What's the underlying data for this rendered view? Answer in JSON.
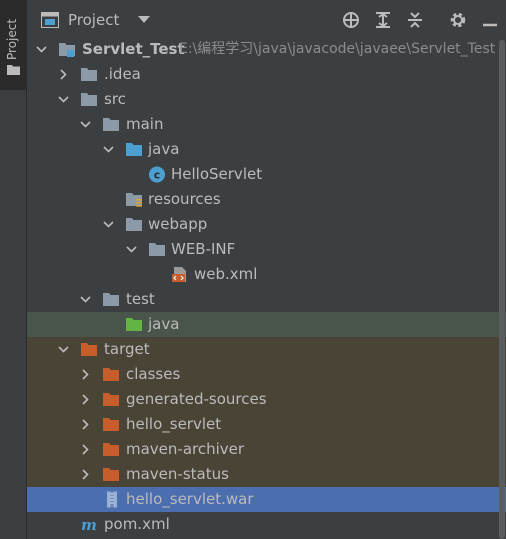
{
  "strip": {
    "tab_label": "Project"
  },
  "header": {
    "title": "Project"
  },
  "colors": {
    "background": "#3c3f41",
    "selection": "#4b6eaf",
    "test_root": "#49544a",
    "excluded": "#4a4436",
    "folder": "#8c9aa8",
    "source_folder": "#4e9fd1",
    "test_folder": "#62b543",
    "excluded_folder": "#c75d2b"
  },
  "tree": {
    "project_name": "Servlet_Test",
    "project_path": "E:\\编程学习\\java\\javacode\\javaee\\Servlet_Test",
    "items": [
      {
        "label": ".idea"
      },
      {
        "label": "src"
      },
      {
        "label": "main"
      },
      {
        "label": "java"
      },
      {
        "label": "HelloServlet"
      },
      {
        "label": "resources"
      },
      {
        "label": "webapp"
      },
      {
        "label": "WEB-INF"
      },
      {
        "label": "web.xml"
      },
      {
        "label": "test"
      },
      {
        "label": "java"
      },
      {
        "label": "target"
      },
      {
        "label": "classes"
      },
      {
        "label": "generated-sources"
      },
      {
        "label": "hello_servlet"
      },
      {
        "label": "maven-archiver"
      },
      {
        "label": "maven-status"
      },
      {
        "label": "hello_servlet.war"
      },
      {
        "label": "pom.xml"
      }
    ]
  }
}
